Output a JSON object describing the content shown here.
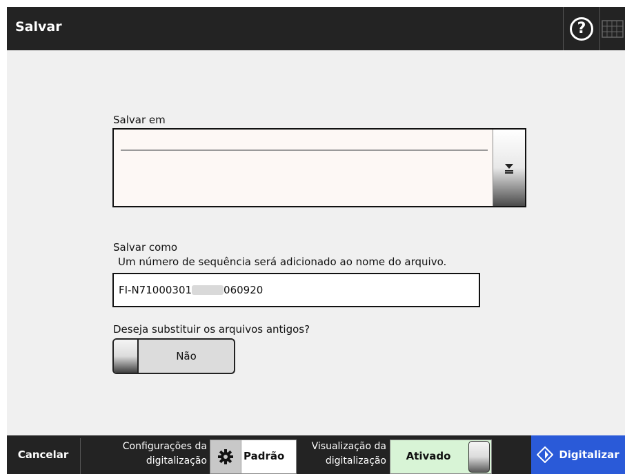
{
  "window": {
    "title": "Salvar"
  },
  "toolbar": {
    "help_icon": "?",
    "keyboard_icon": "keyboard-icon"
  },
  "save_to": {
    "label": "Salvar em",
    "dropdown_icon": "dropdown-arrow-icon"
  },
  "save_as": {
    "label": "Salvar como",
    "note": "Um número de sequência será adicionado ao nome do arquivo.",
    "value_prefix": "FI-N71000301",
    "value_suffix": "060920"
  },
  "overwrite": {
    "label": "Deseja substituir os arquivos antigos?",
    "value": "Não"
  },
  "footer": {
    "cancel_label": "Cancelar",
    "scan_settings_label_1": "Configurações da",
    "scan_settings_label_2": "digitalização",
    "scan_settings_value": "Padrão",
    "preview_label_1": "Visualização da",
    "preview_label_2": "digitalização",
    "preview_value": "Ativado",
    "scan_label": "Digitalizar"
  },
  "colors": {
    "titlebar": "#232323",
    "accent": "#2a5ad8",
    "preview_on": "#d8f4d6",
    "background": "#f0f0f0"
  }
}
